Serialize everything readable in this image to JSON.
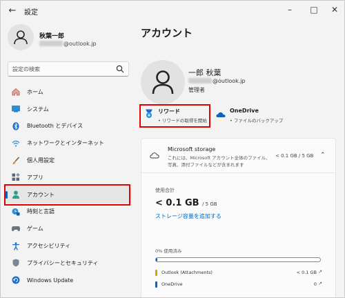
{
  "window": {
    "title": "設定"
  },
  "profile": {
    "name": "秋葉一郎",
    "email_suffix": "@outlook.jp"
  },
  "search": {
    "placeholder": "設定の検索"
  },
  "sidebar": {
    "items": [
      {
        "label": "ホーム",
        "icon": "home-icon"
      },
      {
        "label": "システム",
        "icon": "system-icon"
      },
      {
        "label": "Bluetooth とデバイス",
        "icon": "bluetooth-icon"
      },
      {
        "label": "ネットワークとインターネット",
        "icon": "wifi-icon"
      },
      {
        "label": "個人用設定",
        "icon": "brush-icon"
      },
      {
        "label": "アプリ",
        "icon": "apps-icon"
      },
      {
        "label": "アカウント",
        "icon": "account-icon",
        "active": true
      },
      {
        "label": "時刻と言語",
        "icon": "time-language-icon"
      },
      {
        "label": "ゲーム",
        "icon": "gamepad-icon"
      },
      {
        "label": "アクセシビリティ",
        "icon": "accessibility-icon"
      },
      {
        "label": "プライバシーとセキュリティ",
        "icon": "shield-icon"
      },
      {
        "label": "Windows Update",
        "icon": "windows-update-icon"
      }
    ]
  },
  "main": {
    "title": "アカウント",
    "account": {
      "name": "一郎 秋葉",
      "email_suffix": "@outlook.jp",
      "role": "管理者"
    },
    "services": [
      {
        "label": "リワード",
        "sub": "• リワードの取得を開始"
      },
      {
        "label": "OneDrive",
        "sub": "• ファイルのバックアップ"
      }
    ],
    "storage": {
      "title": "Microsoft storage",
      "desc_line1": "これには、Microsoft アカウント全体のファイル、",
      "desc_line2": "写真、添付ファイルなどが含まれます",
      "amount": "< 0.1 GB / 5 GB",
      "usage_label": "使用合計",
      "usage_value": "< 0.1 GB",
      "usage_of": "/ 5 GB",
      "add_link": "ストレージ容量を追加する",
      "percent_label": "0% 使用済み",
      "used_fraction": 0.01,
      "breakdown": [
        {
          "name": "Outlook (Attachments)",
          "value": "< 0.1 GB",
          "color": "#d8a000"
        },
        {
          "name": "OneDrive",
          "value": "0",
          "color": "#0067c0"
        }
      ]
    }
  },
  "colors": {
    "accent": "#0067c0",
    "highlight": "#e00000"
  }
}
